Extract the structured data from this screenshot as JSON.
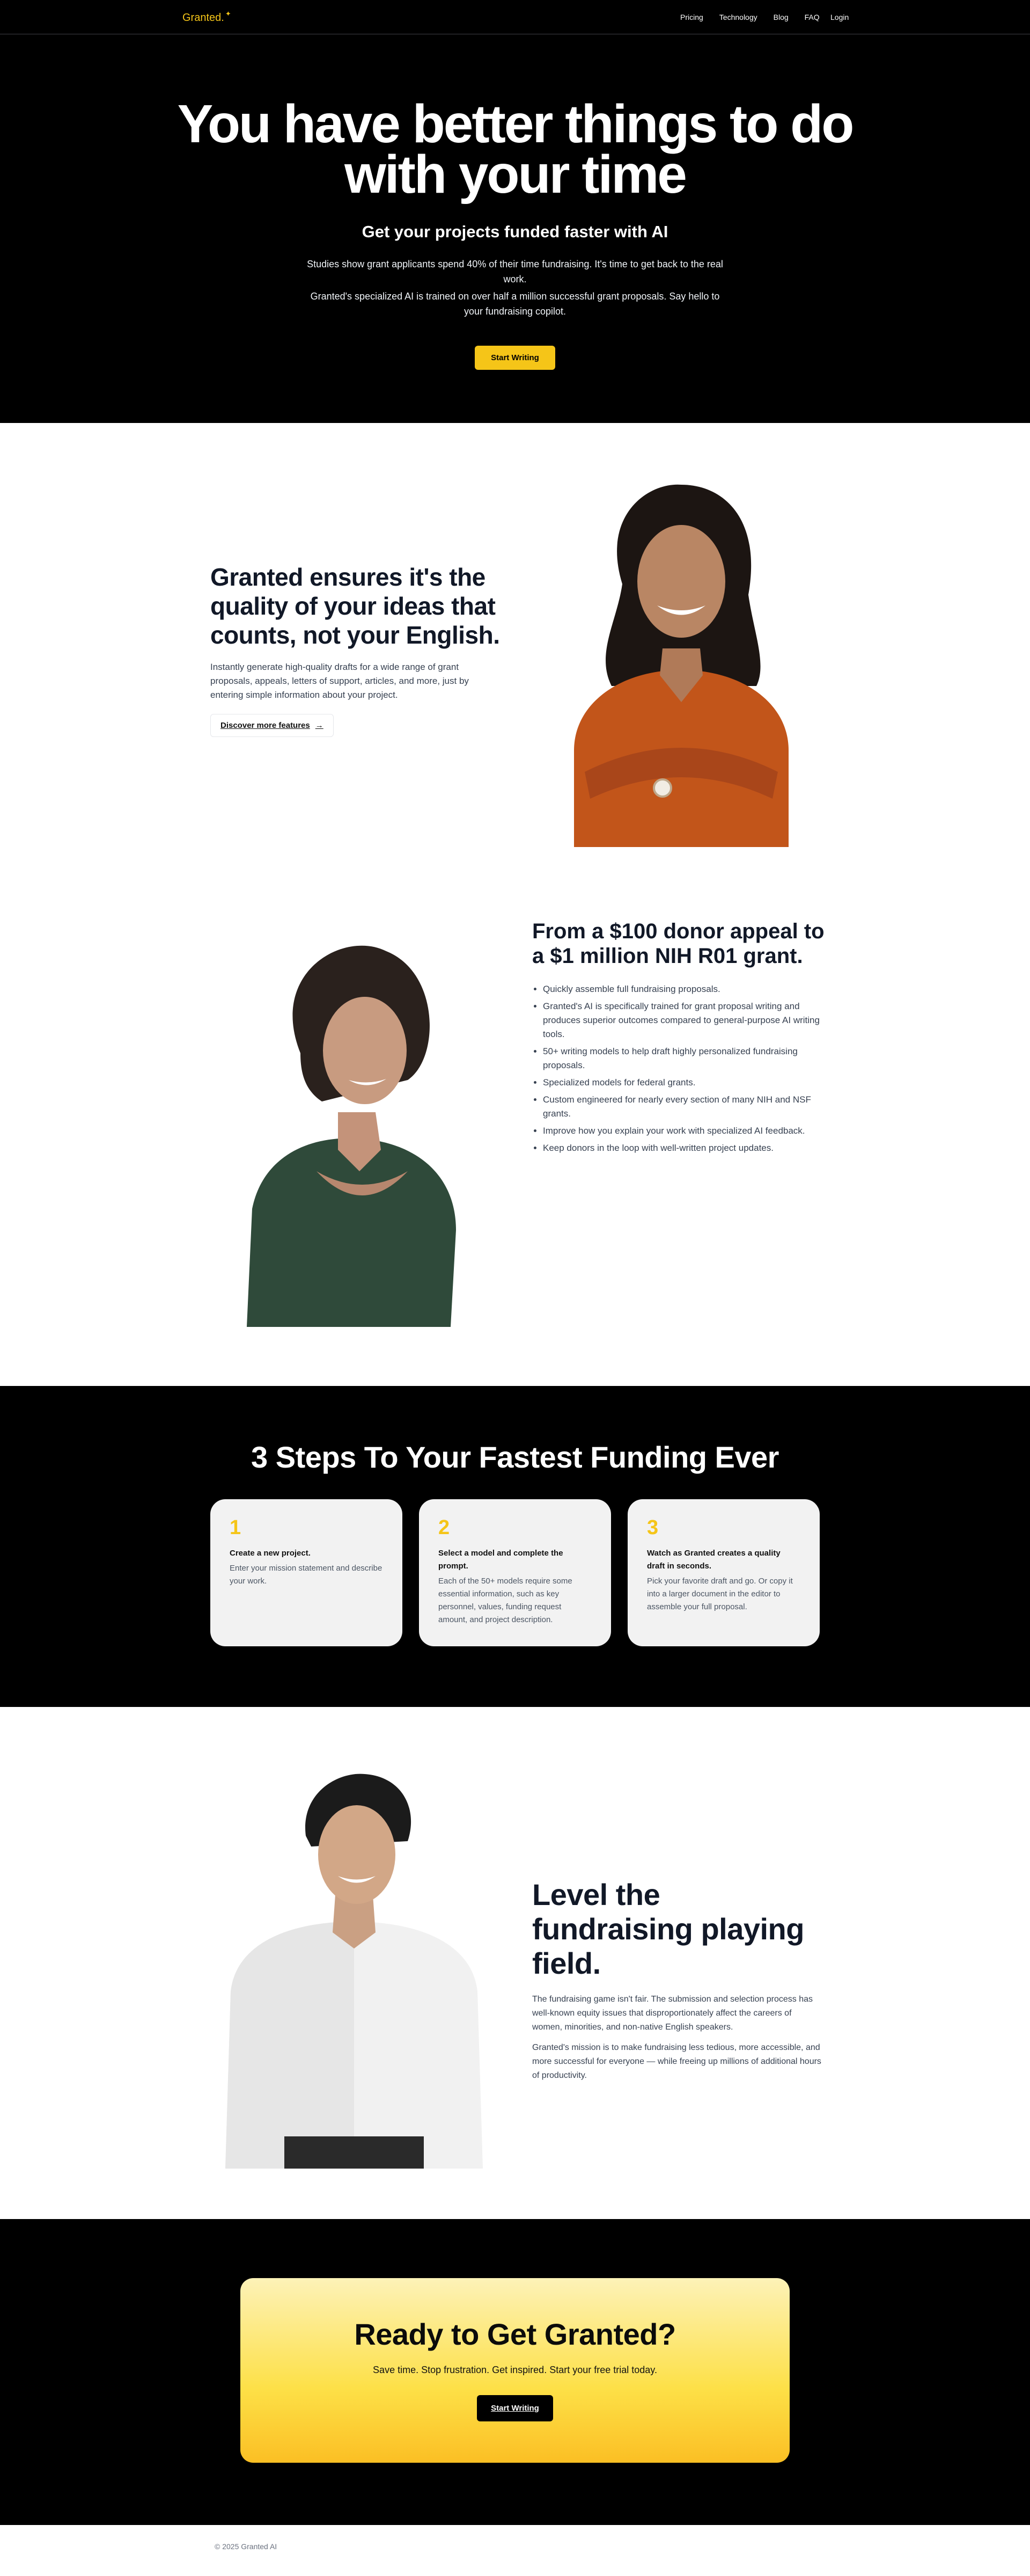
{
  "nav": {
    "brand": "Granted.",
    "brand_mark": "✦",
    "links": [
      "Pricing",
      "Technology",
      "Blog",
      "FAQ"
    ],
    "login": "Login"
  },
  "hero": {
    "title_line1": "You have better things to do",
    "title_line2": "with your time",
    "subtitle": "Get your projects funded faster with AI",
    "para1": "Studies show grant applicants spend 40% of their time fundraising. It's time to get back to the real work.",
    "para2": "Granted's specialized AI is trained on over half a million successful grant proposals. Say hello to your fundraising copilot.",
    "cta": "Start Writing"
  },
  "quality": {
    "heading": "Granted ensures it's the quality of your ideas that counts, not your English.",
    "description": "Instantly generate high-quality drafts for a wide range of grant proposals, appeals, letters of support, articles, and more, just by entering simple information about your project.",
    "button": "Discover more features",
    "button_icon": "→"
  },
  "features": {
    "heading": "From a $100 donor appeal to a $1 million NIH R01 grant.",
    "items": [
      "Quickly assemble full fundraising proposals.",
      "Granted's AI is specifically trained for grant proposal writing and produces superior outcomes compared to general-purpose AI writing tools.",
      "50+ writing models to help draft highly personalized fundraising proposals.",
      "Specialized models for federal grants.",
      "Custom engineered for nearly every section of many NIH and NSF grants.",
      "Improve how you explain your work with specialized AI feedback.",
      "Keep donors in the loop with well-written project updates."
    ]
  },
  "steps": {
    "heading": "3 Steps To Your Fastest Funding Ever",
    "cards": [
      {
        "num": "1",
        "title": "Create a new project.",
        "desc": "Enter your mission statement and describe your work."
      },
      {
        "num": "2",
        "title": "Select a model and complete the prompt.",
        "desc": "Each of the 50+ models require some essential information, such as key personnel, values, funding request amount, and project description."
      },
      {
        "num": "3",
        "title": "Watch as Granted creates a quality draft in seconds.",
        "desc": "Pick your favorite draft and go. Or copy it into a larger document in the editor to assemble your full proposal."
      }
    ]
  },
  "level": {
    "heading": "Level the fundraising playing field.",
    "para1": "The fundraising game isn't fair. The submission and selection process has well-known equity issues that disproportionately affect the careers of women, minorities, and non-native English speakers.",
    "para2": "Granted's mission is to make fundraising less tedious, more accessible, and more successful for everyone — while freeing up millions of additional hours of productivity."
  },
  "cta": {
    "heading": "Ready to Get Granted?",
    "text": "Save time. Stop frustration. Get inspired. Start your free trial today.",
    "button": "Start Writing"
  },
  "footer": {
    "copyright": "© 2025 Granted AI"
  },
  "colors": {
    "accent": "#f5c518",
    "dark": "#000000"
  }
}
